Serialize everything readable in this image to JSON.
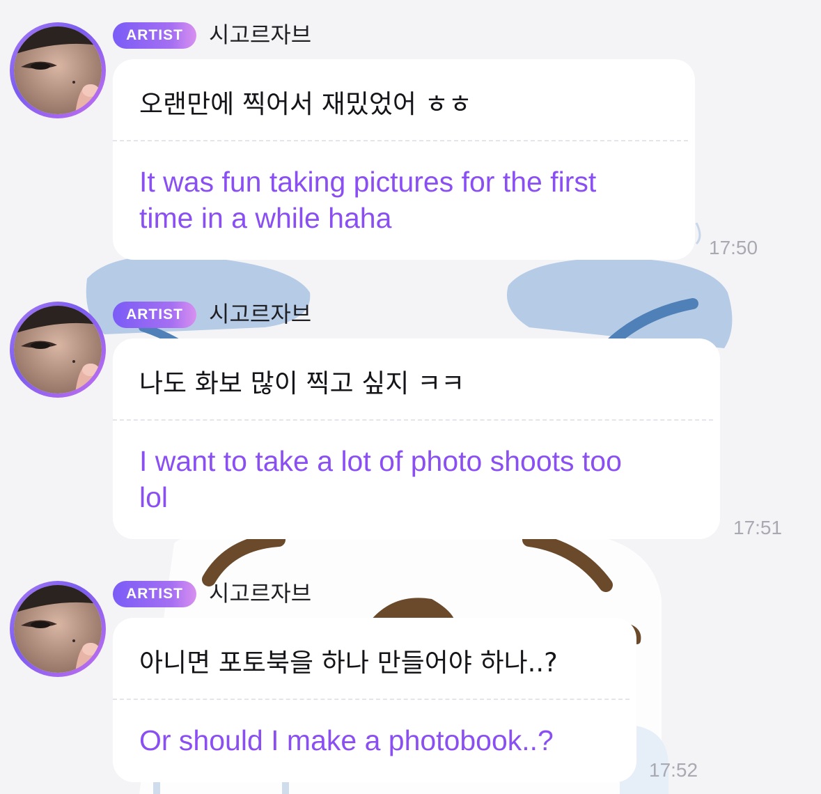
{
  "messages": [
    {
      "badge": "ARTIST",
      "sender": "시고르자브",
      "text_ko": "오랜만에 찍어서 재밌었어 ㅎㅎ",
      "text_en_line1": "It was fun taking pictures for the first",
      "text_en_line2": "time in a while haha",
      "time": "17:50"
    },
    {
      "badge": "ARTIST",
      "sender": "시고르자브",
      "text_ko": "나도 화보 많이 찍고 싶지 ㅋㅋ",
      "text_en_line1": "I want to take a lot of photo shoots too",
      "text_en_line2": "lol",
      "time": "17:51"
    },
    {
      "badge": "ARTIST",
      "sender": "시고르자브",
      "text_ko": "아니면 포토북을 하나 만들어야 하나..?",
      "text_en_line1": "Or should I make a photobook..?",
      "time": "17:52"
    }
  ],
  "colors": {
    "translation_text": "#8a4ff3",
    "badge_gradient_start": "#7a5cf6",
    "badge_gradient_end": "#d890f0",
    "avatar_ring": "#a97cf5",
    "background": "#f4f4f7",
    "bubble": "#ffffff",
    "timestamp": "#a9a9b2"
  },
  "icons": {
    "avatar": "profile-photo",
    "background": "cartoon-wallpaper"
  }
}
